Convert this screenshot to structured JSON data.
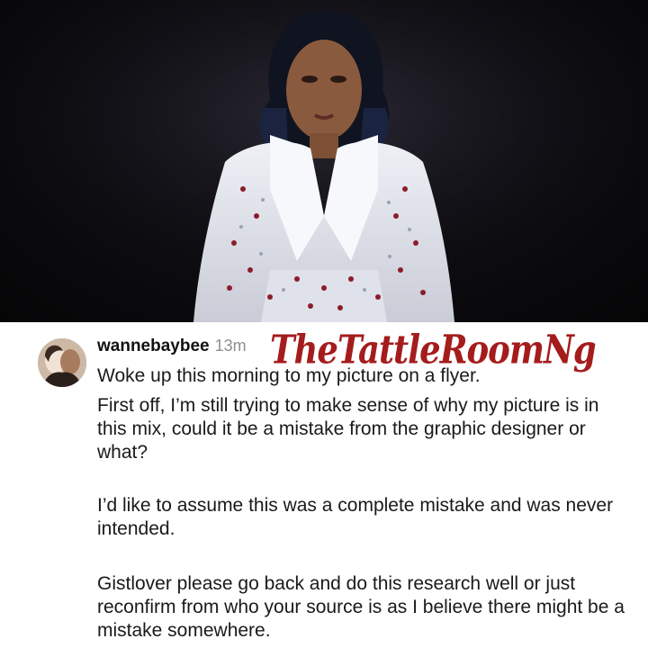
{
  "post": {
    "photo_alt": "woman in white embellished blazer",
    "watermark": "TheTattleRoomNg",
    "colors": {
      "watermark": "#a51c1c",
      "background": "#ffffff",
      "photo_bg": "#0d0c10"
    }
  },
  "comment": {
    "username": "wannebaybee",
    "time": "13m",
    "paragraphs": [
      "Woke up this morning to my picture on a flyer.",
      "First off, I’m still trying to make sense of why my picture is in this mix, could it be a mistake from the graphic designer or what?",
      "I’d like to assume this was a complete mistake and was never intended.",
      "Gistlover please go back and do this research well or just reconfirm from who your source  is as I believe there might be a mistake somewhere."
    ]
  }
}
